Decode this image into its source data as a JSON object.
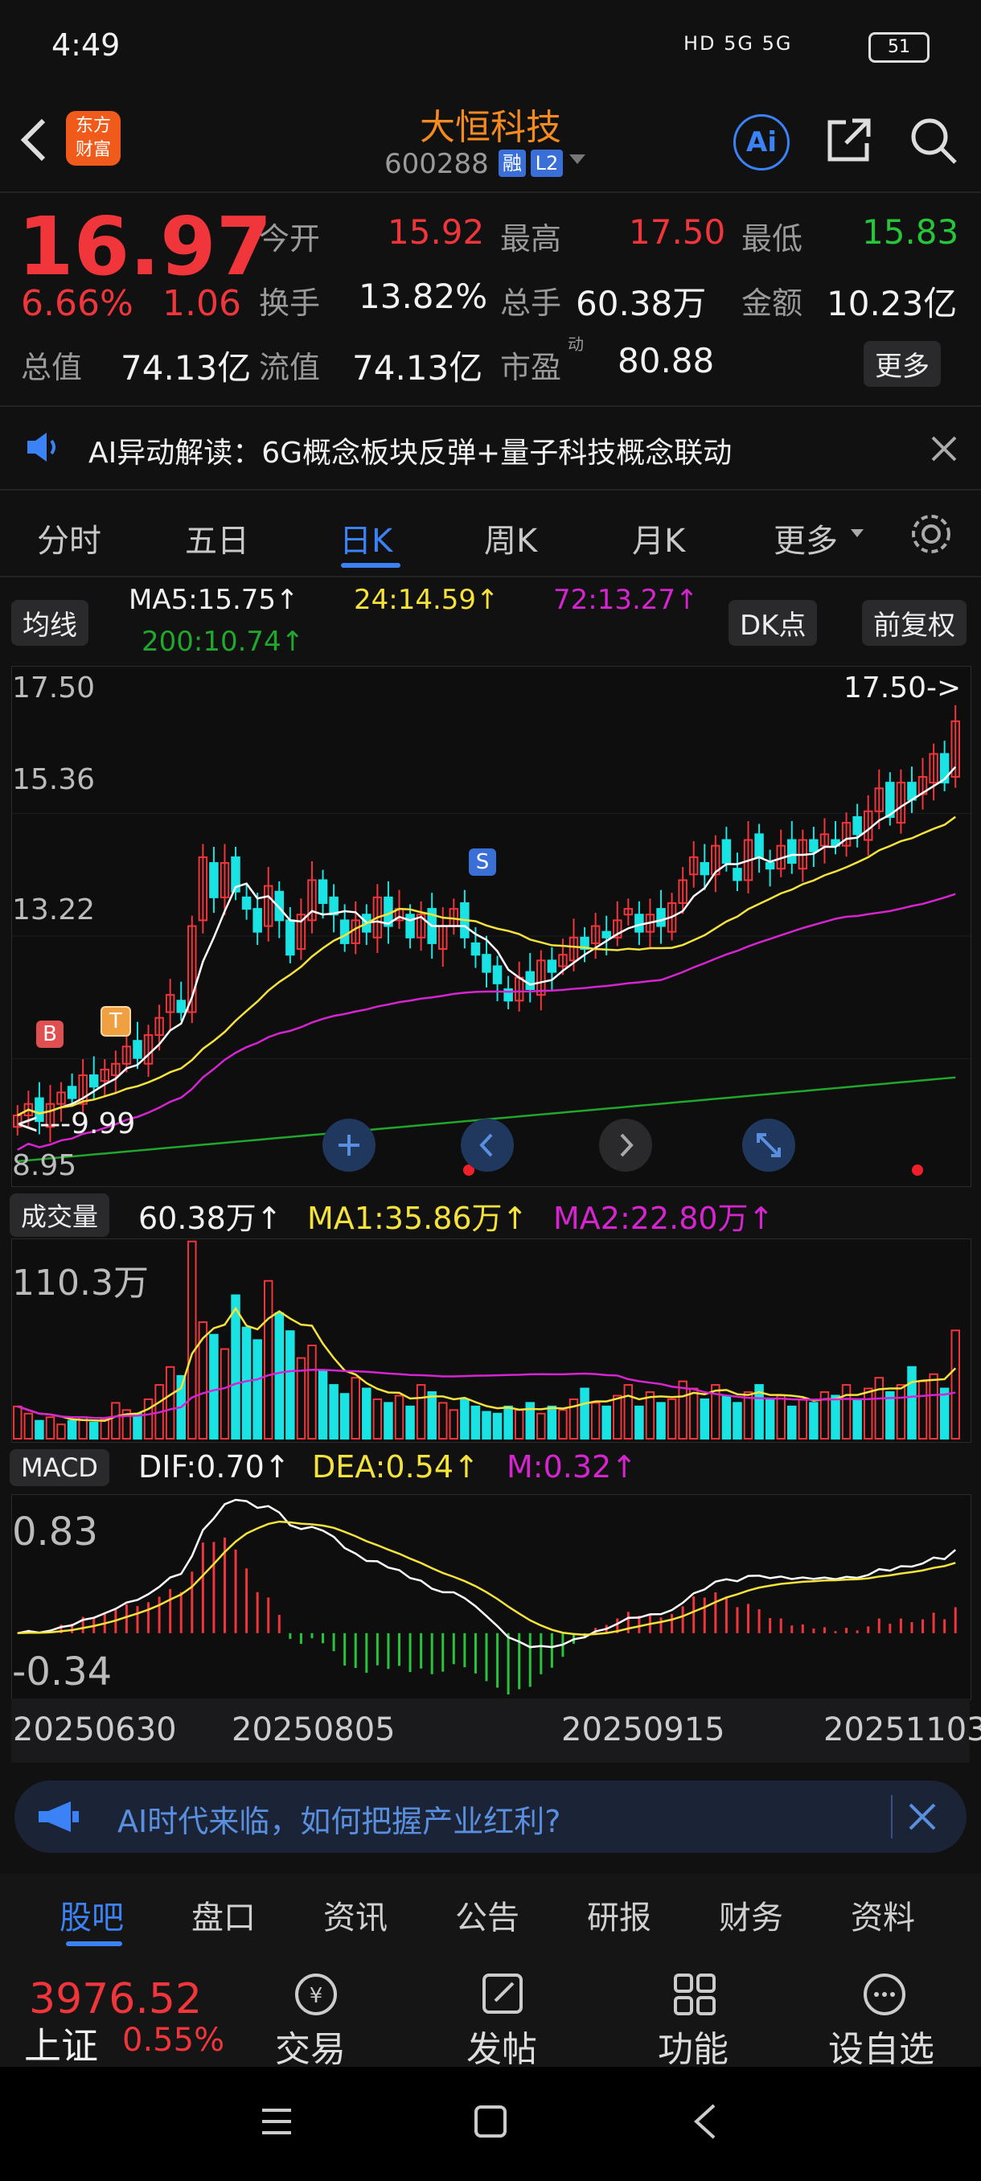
{
  "status": {
    "time": "4:49",
    "network": "HD 5G 5G",
    "battery": "51"
  },
  "header": {
    "logo_line1": "东方",
    "logo_line2": "财富",
    "name": "大恒科技",
    "code": "600288",
    "badge_rong": "融",
    "badge_level": "L2",
    "ai_label": "Ai"
  },
  "quote": {
    "price": "16.97",
    "pct": "6.66%",
    "change": "1.06",
    "open_label": "今开",
    "open": "15.92",
    "high_label": "最高",
    "high": "17.50",
    "low_label": "最低",
    "low": "15.83",
    "turnover_label": "换手",
    "turnover": "13.82%",
    "volume_label": "总手",
    "volume": "60.38万",
    "amount_label": "金额",
    "amount": "10.23亿",
    "mcap_label": "总值",
    "mcap": "74.13亿",
    "float_label": "流值",
    "float": "74.13亿",
    "pe_label": "市盈",
    "pe_sup": "动",
    "pe": "80.88",
    "more": "更多"
  },
  "ai_banner": {
    "text": "AI异动解读：6G概念板块反弹+量子科技概念联动"
  },
  "tabs": [
    "分时",
    "五日",
    "日K",
    "周K",
    "月K",
    "更多"
  ],
  "ma": {
    "selector": "均线",
    "ma5": "MA5:15.75↑",
    "ma24": "24:14.59↑",
    "ma72": "72:13.27↑",
    "ma200": "200:10.74↑",
    "dk": "DK点",
    "fq": "前复权"
  },
  "kline": {
    "y_labels": [
      "17.50",
      "15.36",
      "13.22",
      "8.95"
    ],
    "max_mark": "17.50->",
    "min_mark": "<---9.99",
    "s_label": "S",
    "b_label": "B",
    "t_label": "T"
  },
  "volume": {
    "selector": "成交量",
    "value": "60.38万↑",
    "ma1": "MA1:35.86万↑",
    "ma2": "MA2:22.80万↑",
    "y_max": "110.3万"
  },
  "macd": {
    "selector": "MACD",
    "dif": "DIF:0.70↑",
    "dea": "DEA:0.54↑",
    "m": "M:0.32↑",
    "y_top": "0.83",
    "y_bottom": "-0.34"
  },
  "dates": [
    "20250630",
    "20250805",
    "20250915",
    "20251103"
  ],
  "promo": {
    "text": "AI时代来临，如何把握产业红利?"
  },
  "bottom_tabs": [
    "股吧",
    "盘口",
    "资讯",
    "公告",
    "研报",
    "财务",
    "资料"
  ],
  "footer": {
    "index_value": "3976.52",
    "index_name": "上证",
    "index_pct": "0.55%",
    "trade": "交易",
    "post": "发帖",
    "func": "功能",
    "watch": "设自选"
  },
  "colors": {
    "up": "#f0353b",
    "down": "#27c63a",
    "accent": "#3b82f6",
    "ma5": "#ffffff",
    "ma24": "#f5e33c",
    "ma72": "#d624d0",
    "ma200": "#20a82c",
    "cyan": "#19e3e3"
  },
  "chart_data": [
    {
      "type": "candlestick",
      "title": "日K",
      "ylim": [
        8.95,
        17.5
      ],
      "x": [
        "20250630",
        "20250805",
        "20250915",
        "20251103"
      ],
      "close_series": [
        10.1,
        10.3,
        10.0,
        10.3,
        10.5,
        10.4,
        10.8,
        10.6,
        10.9,
        11.0,
        11.3,
        11.1,
        11.5,
        11.8,
        12.2,
        11.9,
        13.4,
        14.6,
        13.9,
        14.5,
        14.0,
        13.7,
        13.3,
        14.1,
        13.5,
        12.9,
        13.6,
        14.2,
        13.8,
        13.6,
        13.1,
        13.5,
        13.3,
        13.9,
        13.4,
        13.7,
        13.2,
        13.6,
        13.1,
        13.4,
        13.7,
        13.2,
        12.9,
        12.6,
        12.4,
        12.1,
        12.5,
        12.3,
        12.8,
        12.6,
        12.9,
        13.2,
        13.0,
        13.4,
        13.2,
        13.5,
        13.7,
        13.3,
        13.6,
        13.4,
        13.8,
        14.2,
        14.6,
        14.3,
        14.8,
        14.5,
        14.2,
        14.9,
        14.6,
        14.4,
        14.8,
        14.5,
        14.9,
        14.7,
        15.0,
        14.8,
        15.2,
        15.0,
        15.4,
        15.8,
        15.3,
        15.9,
        15.6,
        16.0,
        16.4,
        15.9,
        16.97
      ],
      "ma_series": [
        {
          "name": "MA5",
          "value": 15.75
        },
        {
          "name": "24",
          "value": 14.59
        },
        {
          "name": "72",
          "value": 13.27
        },
        {
          "name": "200",
          "value": 10.74
        }
      ],
      "max": 17.5,
      "min": 9.99
    },
    {
      "type": "bar",
      "title": "成交量",
      "ylim": [
        0,
        110.3
      ],
      "values": [
        18,
        14,
        10,
        12,
        8,
        10,
        12,
        9,
        11,
        20,
        16,
        14,
        22,
        30,
        40,
        35,
        110,
        65,
        58,
        50,
        80,
        62,
        55,
        88,
        70,
        60,
        45,
        52,
        38,
        30,
        25,
        34,
        28,
        22,
        20,
        24,
        18,
        30,
        26,
        20,
        16,
        22,
        18,
        15,
        14,
        18,
        16,
        20,
        14,
        18,
        16,
        22,
        28,
        20,
        18,
        24,
        30,
        18,
        26,
        20,
        22,
        32,
        28,
        22,
        30,
        24,
        20,
        26,
        30,
        22,
        24,
        18,
        22,
        20,
        26,
        24,
        30,
        22,
        28,
        34,
        26,
        30,
        40,
        32,
        36,
        28,
        60.38
      ],
      "ma1": 35.86,
      "ma2": 22.8
    },
    {
      "type": "bar",
      "title": "MACD",
      "ylim": [
        -0.34,
        0.83
      ],
      "dif": 0.7,
      "dea": 0.54,
      "m": 0.32
    }
  ]
}
